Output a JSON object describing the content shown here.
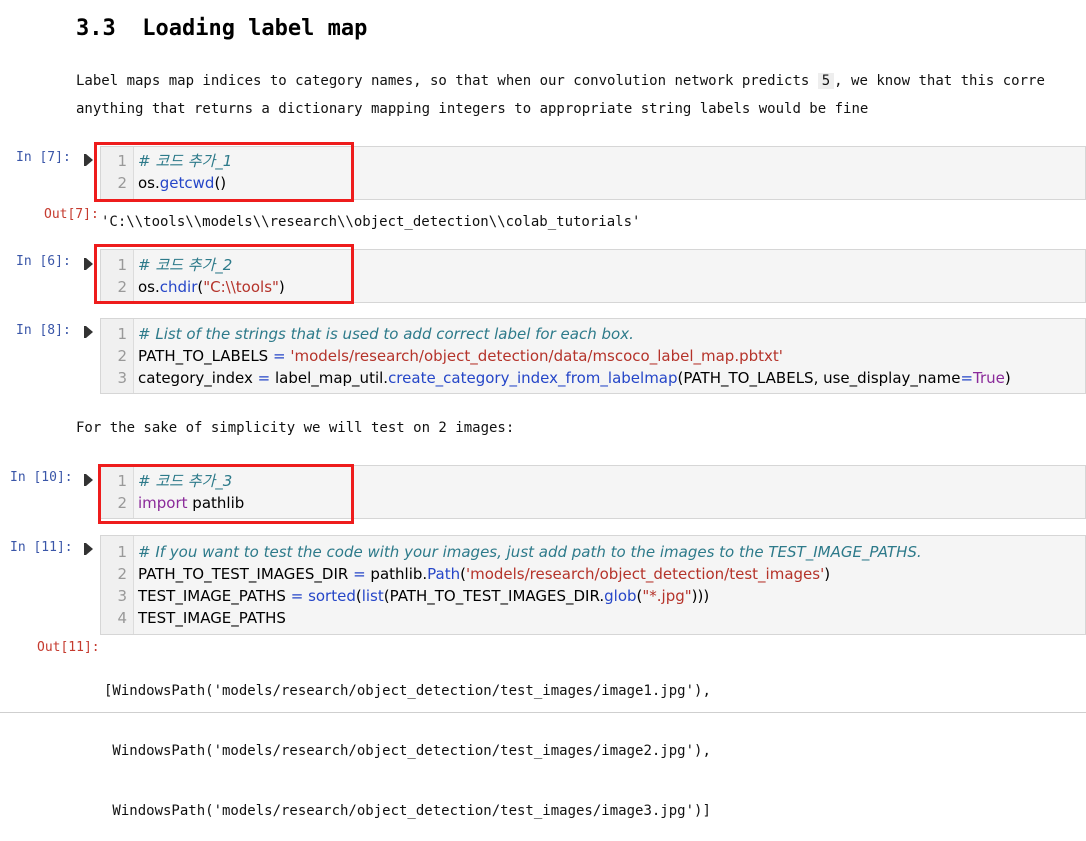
{
  "section": {
    "heading": "3.3  Loading label map",
    "para_line1": "Label maps map indices to category names, so that when our convolution network predicts ",
    "para_inline_code": "5",
    "para_line1_tail": ", we know that this corre",
    "para_line2": "anything that returns a dictionary mapping integers to appropriate string labels would be fine",
    "para_simplicity": "For the sake of simplicity we will test on 2 images:"
  },
  "cells": {
    "c7": {
      "prompt": "In [7]:",
      "lines": [
        {
          "n": "1",
          "t": [
            {
              "c": "# 코드 추가_1",
              "k": "cm"
            }
          ]
        },
        {
          "n": "2",
          "t": [
            {
              "c": "os.",
              "k": ""
            },
            {
              "c": "getcwd",
              "k": "fn"
            },
            {
              "c": "()",
              "k": ""
            }
          ]
        }
      ],
      "out_prompt": "Out[7]:",
      "output": "'C:\\\\tools\\\\models\\\\research\\\\object_detection\\\\colab_tutorials'"
    },
    "c6": {
      "prompt": "In [6]:",
      "lines": [
        {
          "n": "1",
          "t": [
            {
              "c": "# 코드 추가_2",
              "k": "cm"
            }
          ]
        },
        {
          "n": "2",
          "t": [
            {
              "c": "os.",
              "k": ""
            },
            {
              "c": "chdir",
              "k": "fn"
            },
            {
              "c": "(",
              "k": ""
            },
            {
              "c": "\"C:\\\\tools\"",
              "k": "str"
            },
            {
              "c": ")",
              "k": ""
            }
          ]
        }
      ]
    },
    "c8": {
      "prompt": "In [8]:",
      "lines": [
        {
          "n": "1",
          "t": [
            {
              "c": "# List of the strings that is used to add correct label for each box.",
              "k": "cm"
            }
          ]
        },
        {
          "n": "2",
          "t": [
            {
              "c": "PATH_TO_LABELS ",
              "k": ""
            },
            {
              "c": "=",
              "k": "fn"
            },
            {
              "c": " ",
              "k": ""
            },
            {
              "c": "'models/research/object_detection/data/mscoco_label_map.pbtxt'",
              "k": "str"
            }
          ]
        },
        {
          "n": "3",
          "t": [
            {
              "c": "category_index ",
              "k": ""
            },
            {
              "c": "=",
              "k": "fn"
            },
            {
              "c": " label_map_util.",
              "k": ""
            },
            {
              "c": "create_category_index_from_labelmap",
              "k": "fn"
            },
            {
              "c": "(PATH_TO_LABELS, use_display_name",
              "k": ""
            },
            {
              "c": "=",
              "k": "fn"
            },
            {
              "c": "True",
              "k": "kw"
            },
            {
              "c": ")",
              "k": ""
            }
          ]
        }
      ]
    },
    "c10": {
      "prompt": "In [10]:",
      "lines": [
        {
          "n": "1",
          "t": [
            {
              "c": "# 코드 추가_3",
              "k": "cm"
            }
          ]
        },
        {
          "n": "2",
          "t": [
            {
              "c": "import",
              "k": "kw"
            },
            {
              "c": " pathlib",
              "k": ""
            }
          ]
        }
      ]
    },
    "c11": {
      "prompt": "In [11]:",
      "lines": [
        {
          "n": "1",
          "t": [
            {
              "c": "# If you want to test the code with your images, just add path to the images to the TEST_IMAGE_PATHS.",
              "k": "cm"
            }
          ]
        },
        {
          "n": "2",
          "t": [
            {
              "c": "PATH_TO_TEST_IMAGES_DIR ",
              "k": ""
            },
            {
              "c": "=",
              "k": "fn"
            },
            {
              "c": " pathlib.",
              "k": ""
            },
            {
              "c": "Path",
              "k": "fn"
            },
            {
              "c": "(",
              "k": ""
            },
            {
              "c": "'models/research/object_detection/test_images'",
              "k": "str"
            },
            {
              "c": ")",
              "k": ""
            }
          ]
        },
        {
          "n": "3",
          "t": [
            {
              "c": "TEST_IMAGE_PATHS ",
              "k": ""
            },
            {
              "c": "=",
              "k": "fn"
            },
            {
              "c": " ",
              "k": ""
            },
            {
              "c": "sorted",
              "k": "fn"
            },
            {
              "c": "(",
              "k": ""
            },
            {
              "c": "list",
              "k": "fn"
            },
            {
              "c": "(PATH_TO_TEST_IMAGES_DIR.",
              "k": ""
            },
            {
              "c": "glob",
              "k": "fn"
            },
            {
              "c": "(",
              "k": ""
            },
            {
              "c": "\"*.jpg\"",
              "k": "str"
            },
            {
              "c": ")))",
              "k": ""
            }
          ]
        },
        {
          "n": "4",
          "t": [
            {
              "c": "TEST_IMAGE_PATHS",
              "k": ""
            }
          ]
        }
      ],
      "out_prompt": "Out[11]:",
      "output_lines": [
        "[WindowsPath('models/research/object_detection/test_images/image1.jpg'),",
        " WindowsPath('models/research/object_detection/test_images/image2.jpg'),",
        " WindowsPath('models/research/object_detection/test_images/image3.jpg')]"
      ]
    }
  },
  "icons": {
    "run": "run-cell-icon"
  },
  "colors": {
    "highlight_box": "#ee1c1c",
    "prompt": "#3a56a8",
    "out_prompt": "#c53a2e"
  }
}
